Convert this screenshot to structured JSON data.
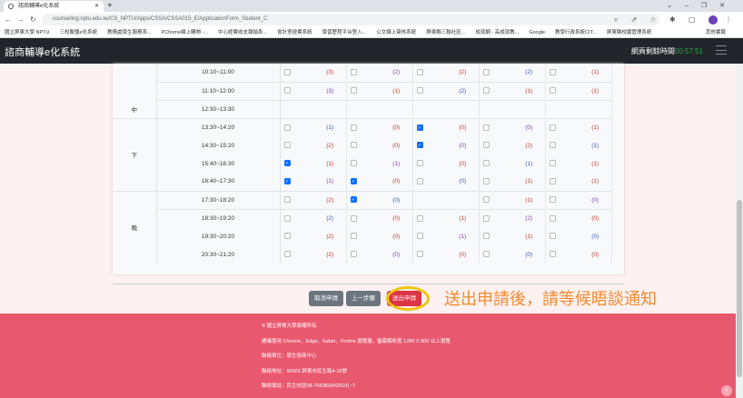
{
  "browser": {
    "tab_title": "諮商輔導e化系統",
    "url": "counseling.nptu.edu.tw/CS_NPTU/Apps/CSSA/CSSA015_E/ApplicationForm_Student_C",
    "bookmarks": [
      "國立屏東大學 NPTU",
      "三校聯盟e化系統",
      "教務處學生服務系...",
      "PChome線上購物 -...",
      "中心經費收支報銷系...",
      "會計室經費系統",
      "學習歷程平台登入...",
      "公文線上簽核系統",
      "屏東縣三聯社區...",
      "成就網 - 高成就教...",
      "Google",
      "教學行政系統CIT...",
      "屏東縣校園管理系統",
      "其他書籤"
    ]
  },
  "nav": {
    "brand": "諮商輔導e化系統",
    "timer_label": "網頁剩餘時間",
    "timer_value": "00:57:51"
  },
  "schedule": {
    "rows": [
      {
        "period": "",
        "time": "10:10~11:00",
        "cells": [
          [
            false,
            "(3)"
          ],
          [
            false,
            "(2)"
          ],
          [
            false,
            "(2)"
          ],
          [
            false,
            "(2)"
          ],
          [
            false,
            "(1)"
          ]
        ]
      },
      {
        "period": "",
        "time": "11:10~12:00",
        "cells": [
          [
            false,
            "(3)"
          ],
          [
            false,
            "(1)"
          ],
          [
            false,
            "(2)"
          ],
          [
            false,
            "(1)"
          ],
          [
            false,
            "(1)"
          ]
        ]
      },
      {
        "period": "中",
        "time": "12:30~13:30",
        "cells": [
          null,
          null,
          null,
          null,
          null
        ]
      },
      {
        "period": "",
        "time": "13:30~14:20",
        "cells": [
          [
            false,
            "(1)"
          ],
          [
            false,
            "(0)"
          ],
          [
            true,
            "(0)"
          ],
          [
            false,
            "(0)"
          ],
          [
            false,
            "(1)"
          ]
        ]
      },
      {
        "period": "下",
        "time": "14:30~15:20",
        "cells": [
          [
            false,
            "(2)"
          ],
          [
            false,
            "(0)"
          ],
          [
            true,
            "(0)"
          ],
          [
            false,
            "(2)"
          ],
          [
            false,
            "(1)"
          ]
        ]
      },
      {
        "period": "",
        "time": "15:40~16:30",
        "cells": [
          [
            true,
            "(1)"
          ],
          [
            false,
            "(1)"
          ],
          [
            false,
            "(0)"
          ],
          [
            false,
            "(1)"
          ],
          [
            false,
            "(1)"
          ]
        ]
      },
      {
        "period": "",
        "time": "16:40~17:30",
        "cells": [
          [
            true,
            "(1)"
          ],
          [
            true,
            "(0)"
          ],
          [
            false,
            "(0)"
          ],
          [
            false,
            "(1)"
          ],
          [
            false,
            "(1)"
          ]
        ]
      },
      {
        "period": "",
        "time": "17:30~18:20",
        "cells": [
          [
            false,
            "(2)"
          ],
          [
            true,
            "(0)"
          ],
          null,
          [
            false,
            "(1)"
          ],
          [
            false,
            "(0)"
          ]
        ]
      },
      {
        "period": "晚",
        "time": "18:30~19:20",
        "cells": [
          [
            false,
            "(2)"
          ],
          [
            false,
            "(0)"
          ],
          [
            false,
            "(1)"
          ],
          [
            false,
            "(2)"
          ],
          [
            false,
            "(0)"
          ]
        ]
      },
      {
        "period": "",
        "time": "19:30~20:20",
        "cells": [
          [
            false,
            "(2)"
          ],
          [
            false,
            "(0)"
          ],
          [
            false,
            "(1)"
          ],
          [
            false,
            "(1)"
          ],
          [
            false,
            "(0)"
          ]
        ]
      },
      {
        "period": "",
        "time": "20:30~21:20",
        "cells": [
          [
            false,
            "(2)"
          ],
          [
            false,
            "(0)"
          ],
          [
            false,
            "(0)"
          ],
          [
            false,
            "(0)"
          ],
          [
            false,
            "(0)"
          ]
        ]
      }
    ]
  },
  "actions": {
    "cancel": "取消申請",
    "back": "上一步驟",
    "submit": "送出申請"
  },
  "annotation": "送出申請後，請等候晤談通知",
  "footer": [
    "© 國立屏東大學版權所有",
    "建議使用 Chrome、Edge、Safari、Firefox 瀏覽器，螢幕解析度 1280 X 800 以上瀏覽",
    "聯絡單位：學生諮商中心",
    "聯絡地址：90003 屏東市民生路4-18號",
    "聯絡電話：民生校區08-7663800#25101~7"
  ],
  "colors": {
    "navbar": "#212529",
    "footer": "#e8596f",
    "submit": "#dc3545",
    "annotation": "#f28a2e",
    "highlight": "#f2c40f"
  }
}
